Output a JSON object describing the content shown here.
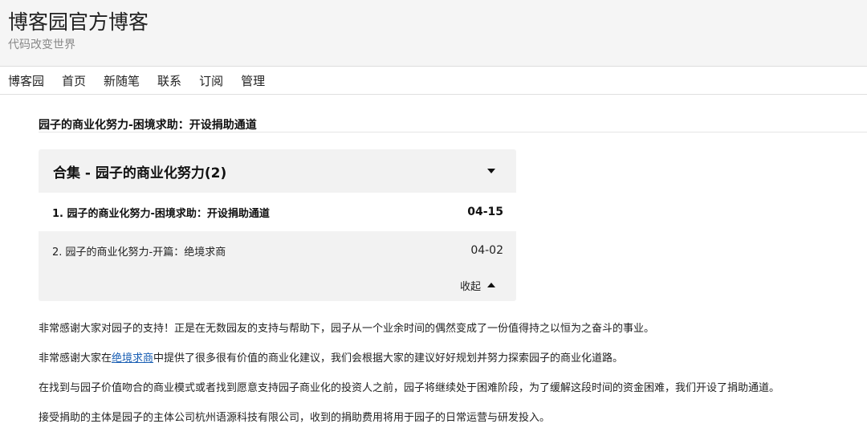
{
  "header": {
    "site_title": "博客园官方博客",
    "subtitle": "代码改变世界"
  },
  "nav": {
    "items": [
      "博客园",
      "首页",
      "新随笔",
      "联系",
      "订阅",
      "管理"
    ]
  },
  "post": {
    "title": "园子的商业化努力-困境求助：开设捐助通道"
  },
  "collection": {
    "title": "合集 - 园子的商业化努力(2)",
    "items": [
      {
        "label": "1. 园子的商业化努力-困境求助：开设捐助通道",
        "date": "04-15"
      },
      {
        "label": "2. 园子的商业化努力-开篇：绝境求商",
        "date": "04-02"
      }
    ],
    "collapse_label": "收起"
  },
  "content": {
    "p1": "非常感谢大家对园子的支持！正是在无数园友的支持与帮助下，园子从一个业余时间的偶然变成了一份值得持之以恒为之奋斗的事业。",
    "p2_before": "非常感谢大家在",
    "p2_link": "绝境求商",
    "p2_after": "中提供了很多很有价值的商业化建议，我们会根据大家的建议好好规划并努力探索园子的商业化道路。",
    "p3": "在找到与园子价值吻合的商业模式或者找到愿意支持园子商业化的投资人之前，园子将继续处于困难阶段，为了缓解这段时间的资金困难，我们开设了捐助通道。",
    "p4": "接受捐助的主体是园子的主体公司杭州语源科技有限公司，收到的捐助费用将用于园子的日常运营与研发投入。"
  },
  "colors": {
    "link": "#1a5fb4",
    "panel_bg": "#f2f2f2",
    "header_bg": "#f5f5f5"
  }
}
